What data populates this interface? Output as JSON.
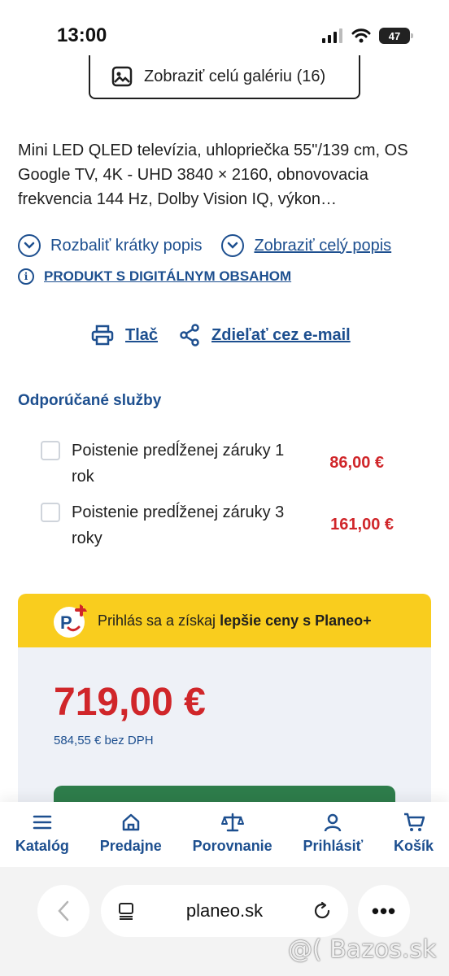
{
  "status_bar": {
    "time": "13:00",
    "battery": "47"
  },
  "gallery": {
    "label": "Zobraziť celú galériu (16)"
  },
  "description": "Mini LED QLED televízia, uhlopriečka 55\"/139 cm, OS Google TV, 4K - UHD 3840 × 2160, obnovovacia frekvencia 144 Hz, Dolby Vision IQ, výkon…",
  "links": {
    "expand_short": "Rozbaliť krátky popis",
    "show_full": "Zobraziť celý popis",
    "digital": "PRODUKT S DIGITÁLNYM OBSAHOM",
    "print": "Tlač",
    "share": "Zdieľať cez e-mail"
  },
  "services": {
    "title": "Odporúčané služby",
    "items": [
      {
        "name": "Poistenie predĺženej záruky 1 rok",
        "price": "86,00 €"
      },
      {
        "name": "Poistenie predĺženej záruky 3 roky",
        "price": "161,00 €"
      }
    ]
  },
  "promo": {
    "text_prefix": "Prihlás sa a získaj ",
    "text_bold": "lepšie ceny s Planeo+"
  },
  "price": {
    "main": "719,00 €",
    "without_vat": "584,55 € bez DPH"
  },
  "nav": {
    "items": [
      {
        "label": "Katalóg",
        "icon": "menu-icon"
      },
      {
        "label": "Predajne",
        "icon": "store-icon"
      },
      {
        "label": "Porovnanie",
        "icon": "scale-icon"
      },
      {
        "label": "Prihlásiť",
        "icon": "user-icon"
      },
      {
        "label": "Košík",
        "icon": "cart-icon"
      }
    ]
  },
  "browser": {
    "url": "planeo.sk"
  },
  "watermark": "@( Bazos.sk",
  "colors": {
    "brand_blue": "#1d4f8f",
    "price_red": "#d0262a",
    "promo_yellow": "#f9cd1e",
    "buy_green": "#2e7d4b"
  }
}
